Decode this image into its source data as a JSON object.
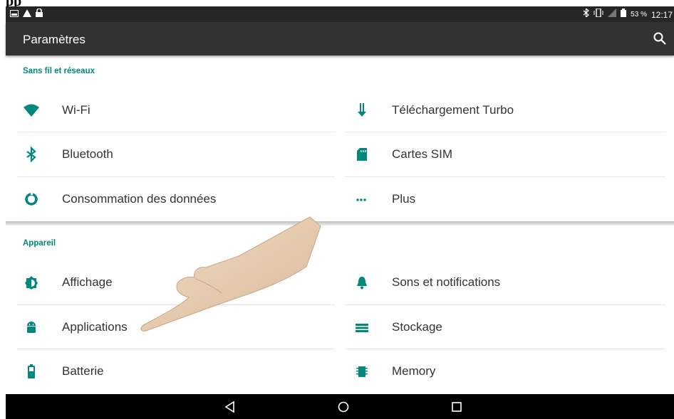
{
  "caption_fragment": "pp",
  "status_bar": {
    "battery_percent": "53 %",
    "time": "12:17",
    "left_icons": [
      "image-icon",
      "warning-icon",
      "lock-icon"
    ],
    "right_icons": [
      "bluetooth-icon",
      "vibrate-icon",
      "signal-off-icon",
      "battery-icon"
    ]
  },
  "app_bar": {
    "title": "Paramètres"
  },
  "sections": {
    "wireless": {
      "title": "Sans fil et réseaux",
      "left": [
        {
          "label": "Wi-Fi",
          "icon": "wifi-icon"
        },
        {
          "label": "Bluetooth",
          "icon": "bluetooth-icon"
        },
        {
          "label": "Consommation des données",
          "icon": "data-usage-icon"
        }
      ],
      "right": [
        {
          "label": "Téléchargement Turbo",
          "icon": "download-icon"
        },
        {
          "label": "Cartes SIM",
          "icon": "sim-card-icon"
        },
        {
          "label": "Plus",
          "icon": "more-icon"
        }
      ]
    },
    "device": {
      "title": "Appareil",
      "left": [
        {
          "label": "Affichage",
          "icon": "brightness-icon"
        },
        {
          "label": "Applications",
          "icon": "android-icon"
        },
        {
          "label": "Batterie",
          "icon": "battery-icon"
        }
      ],
      "right": [
        {
          "label": "Sons et notifications",
          "icon": "bell-icon"
        },
        {
          "label": "Stockage",
          "icon": "storage-icon"
        },
        {
          "label": "Memory",
          "icon": "memory-chip-icon"
        }
      ]
    }
  },
  "colors": {
    "accent": "#00897b",
    "app_bar": "#323232",
    "status_bar": "#262626",
    "nav_bar": "#000000"
  }
}
